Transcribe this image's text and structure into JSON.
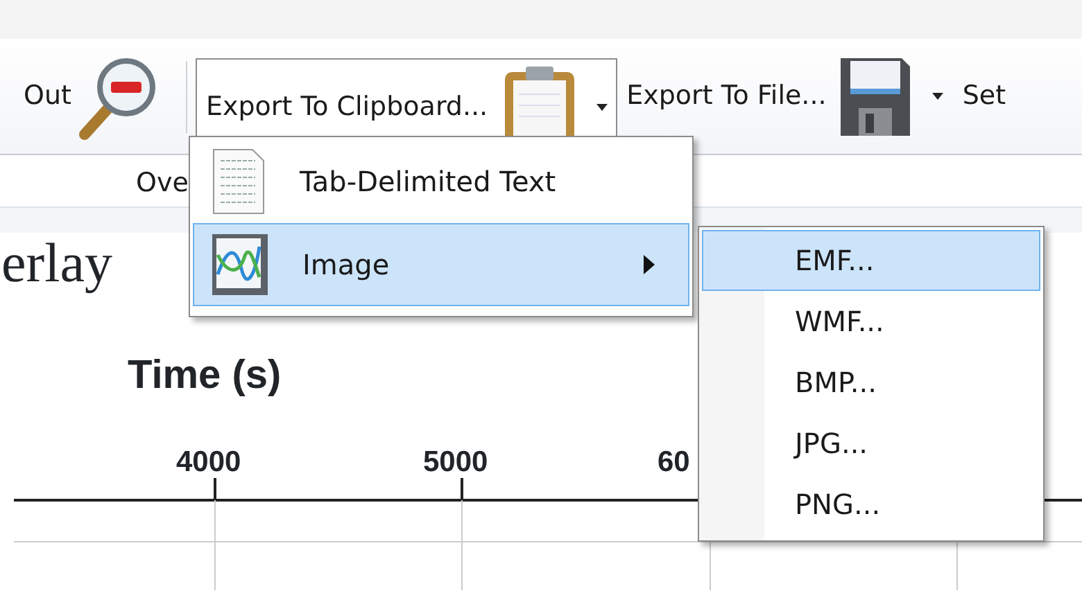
{
  "ribbon": {
    "buttons": [
      {
        "label": "Out",
        "pressed": false,
        "dropdown": false
      },
      {
        "label": "Export To Clipboard...",
        "pressed": true,
        "dropdown": true
      },
      {
        "label": "Export To File...",
        "pressed": false,
        "dropdown": true
      },
      {
        "label": "Set",
        "pressed": false,
        "dropdown": false
      }
    ],
    "group_label": "Ove"
  },
  "menu": {
    "items": [
      {
        "label": "Tab-Delimited Text",
        "selected": false,
        "submenu": false
      },
      {
        "label": "Image",
        "selected": true,
        "submenu": true
      }
    ]
  },
  "submenu": {
    "items": [
      {
        "label": "EMF...",
        "selected": true
      },
      {
        "label": "WMF...",
        "selected": false
      },
      {
        "label": "BMP...",
        "selected": false
      },
      {
        "label": "JPG...",
        "selected": false
      },
      {
        "label": "PNG...",
        "selected": false
      }
    ]
  },
  "chart": {
    "title": "erlay",
    "axis_title": "Time (s)",
    "ticks": [
      "4000",
      "5000",
      "60"
    ]
  }
}
